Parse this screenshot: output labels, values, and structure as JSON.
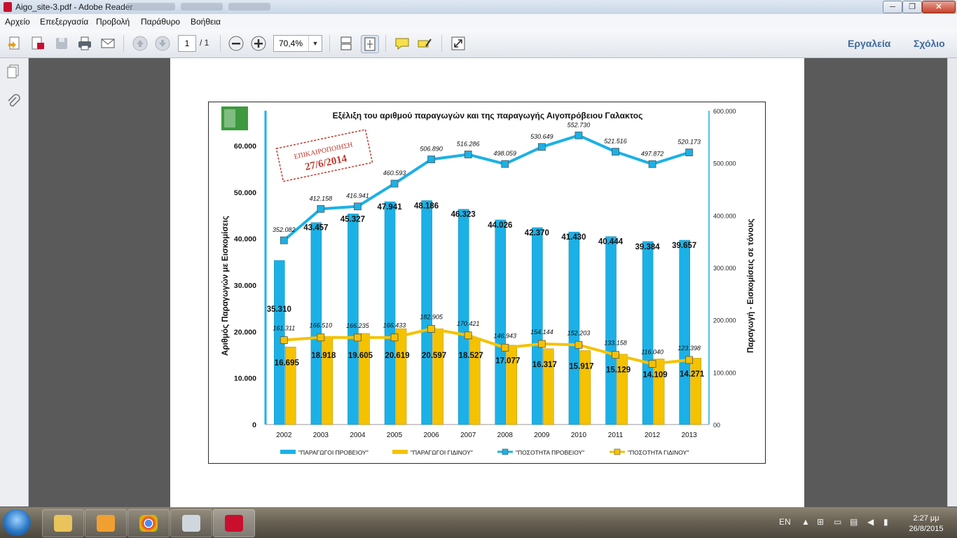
{
  "window": {
    "title": "Aigo_site-3.pdf - Adobe Reader"
  },
  "menu": [
    "Αρχείο",
    "Επεξεργασία",
    "Προβολή",
    "Παράθυρο",
    "Βοήθεια"
  ],
  "toolbar": {
    "page_current": "1",
    "page_total": "/ 1",
    "zoom": "70,4%",
    "tools_label": "Εργαλεία",
    "comment_label": "Σχόλιο"
  },
  "taskbar": {
    "language": "EN",
    "time": "2:27 μμ",
    "date": "26/8/2015"
  },
  "stamp": {
    "line1": "ΕΠΙΚΑΙΡΟΠΟΙΗΣΗ",
    "line2": "27/6/2014"
  },
  "colors": {
    "sheep": "#1bb1e6",
    "goat": "#f5c200",
    "accent": "#3f6aa1"
  },
  "chart_data": {
    "type": "bar+line",
    "title": "Εξέλιξη του αριθμού παραγωγών και της παραγωγής Αιγοπρόβειου Γαλακτος",
    "ylabel_left": "Αριθμός Παραγωγών με Εισκομίσεις",
    "ylabel_right": "Παραγωγή - Εισκομίσεις σε τόνους",
    "categories": [
      "2002",
      "2003",
      "2004",
      "2005",
      "2006",
      "2007",
      "2008",
      "2009",
      "2010",
      "2011",
      "2012",
      "2013"
    ],
    "ylim_left": [
      0,
      60000
    ],
    "ylim_right": [
      0,
      600000
    ],
    "yticks_left": [
      "0",
      "10.000",
      "20.000",
      "30.000",
      "40.000",
      "50.000",
      "60.000"
    ],
    "yticks_right": [
      "00",
      "100.000",
      "200.000",
      "300.000",
      "400.000",
      "500.000",
      "600.000"
    ],
    "legend_position": "bottom",
    "series": [
      {
        "name": "\"ΠΑΡΑΓΩΓΟΙ ΠΡΟΒΕΙΟΥ\"",
        "type": "bar",
        "axis": "left",
        "color": "#1bb1e6",
        "values": [
          35310,
          43457,
          45327,
          47941,
          48186,
          46323,
          44026,
          42370,
          41430,
          40444,
          39384,
          39657
        ],
        "labels": [
          "35.310",
          "43.457",
          "45.327",
          "47.941",
          "48.186",
          "46.323",
          "44.026",
          "42.370",
          "41.430",
          "40.444",
          "39.384",
          "39.657"
        ]
      },
      {
        "name": "\"ΠΑΡΑΓΩΓΟΙ ΓΙΔΙΝΟΥ\"",
        "type": "bar",
        "axis": "left",
        "color": "#f5c200",
        "values": [
          16695,
          18918,
          19605,
          20619,
          20597,
          18527,
          17077,
          16317,
          15917,
          15129,
          14109,
          14271
        ],
        "labels": [
          "16.695",
          "18.918",
          "19.605",
          "20.619",
          "20.597",
          "18.527",
          "17.077",
          "16.317",
          "15.917",
          "15.129",
          "14.109",
          "14.271"
        ]
      },
      {
        "name": "\"ΠΟΣΟΤΗΤΑ ΠΡΟΒΕΙΟΥ\"",
        "type": "line",
        "axis": "right",
        "color": "#1bb1e6",
        "values": [
          352082,
          412158,
          416941,
          460593,
          506890,
          516286,
          498059,
          530649,
          552730,
          521516,
          497872,
          520173
        ],
        "labels": [
          "352.082",
          "412.158",
          "416.941",
          "460.593",
          "506.890",
          "516.286",
          "498.059",
          "530.649",
          "552.730",
          "521.516",
          "497.872",
          "520.173"
        ]
      },
      {
        "name": "\"ΠΟΣΟΤΗΤΑ ΓΙΔΙΝΟΥ\"",
        "type": "line",
        "axis": "right",
        "color": "#f5c200",
        "values": [
          161311,
          166510,
          166235,
          166433,
          182905,
          170421,
          146943,
          154144,
          152203,
          133158,
          116040,
          123398
        ],
        "labels": [
          "161.311",
          "166.510",
          "166.235",
          "166.433",
          "182.905",
          "170.421",
          "146.943",
          "154.144",
          "152.203",
          "133.158",
          "116.040",
          "123.398"
        ]
      }
    ]
  }
}
